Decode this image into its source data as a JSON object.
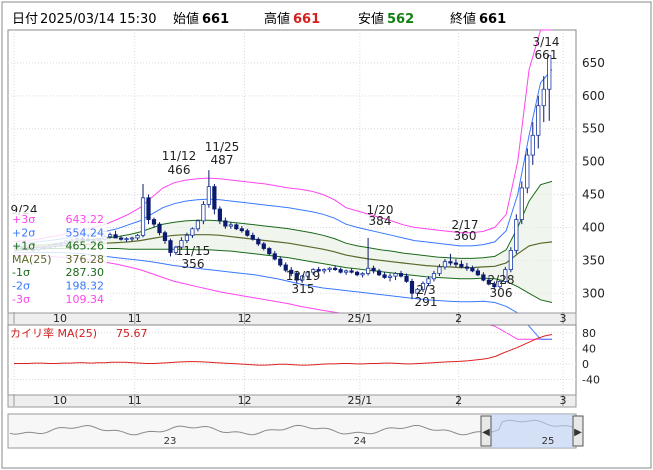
{
  "header": {
    "date_label": "日付",
    "date_value": "2025/03/14 15:30",
    "open_label": "始値",
    "open_value": "661",
    "high_label": "高値",
    "high_value": "661",
    "low_label": "安値",
    "low_value": "562",
    "close_label": "終値",
    "close_value": "661"
  },
  "colors": {
    "up": "#1a3aa8",
    "down": "#0a1a6e",
    "band3": "#ff44ee",
    "band2": "#3a78ff",
    "band1": "#1a6a1a",
    "ma": "#5a6a2a",
    "high": "#d22020",
    "low": "#128012",
    "sub_line": "#dd2222"
  },
  "legend": [
    {
      "label": "+3σ",
      "value": "643.22",
      "color": "#ff44ee"
    },
    {
      "label": "+2σ",
      "value": "554.24",
      "color": "#3a78ff"
    },
    {
      "label": "+1σ",
      "value": "465.26",
      "color": "#1a6a1a"
    },
    {
      "label": "MA(25)",
      "value": "376.28",
      "color": "#5a6a2a"
    },
    {
      "label": "-1σ",
      "value": "287.30",
      "color": "#1a6a1a"
    },
    {
      "label": "-2σ",
      "value": "198.32",
      "color": "#3a78ff"
    },
    {
      "label": "-3σ",
      "value": "109.34",
      "color": "#ff44ee"
    }
  ],
  "month_labels": [
    "10",
    "11",
    "12",
    "25/1",
    "2",
    "3"
  ],
  "annotations": [
    {
      "date": "9/24",
      "value": ""
    },
    {
      "date": "11/12",
      "value": "466"
    },
    {
      "date": "11/25",
      "value": "487"
    },
    {
      "date": "1/20",
      "value": "384"
    },
    {
      "date": "2/17",
      "value": "360"
    },
    {
      "date": "3/14",
      "value": "661"
    },
    {
      "date": "11/15",
      "value": "356"
    },
    {
      "date": "12/19",
      "value": "315"
    },
    {
      "date": "2/3",
      "value": "291"
    },
    {
      "date": "2/28",
      "value": "306"
    }
  ],
  "sub_panel": {
    "label": "カイリ率 MA(25)",
    "value": "75.67",
    "y_ticks": [
      "80",
      "40",
      "0",
      "-40"
    ]
  },
  "navigator": {
    "labels": [
      "23",
      "24",
      "25"
    ],
    "left_button": "◀",
    "right_button": "▶"
  },
  "chart_data": {
    "type": "candlestick",
    "ylim": [
      270,
      700
    ],
    "y_ticks": [
      300,
      350,
      400,
      450,
      500,
      550,
      600,
      650
    ],
    "x_months": [
      {
        "label": "10",
        "index": 0
      },
      {
        "label": "11",
        "index": 22
      },
      {
        "label": "12",
        "index": 42
      },
      {
        "label": "25/1",
        "index": 63
      },
      {
        "label": "2",
        "index": 81
      },
      {
        "label": "3",
        "index": 100
      }
    ],
    "candles": [
      [
        370,
        372,
        366,
        369
      ],
      [
        369,
        371,
        365,
        368
      ],
      [
        368,
        370,
        364,
        367
      ],
      [
        367,
        369,
        363,
        366
      ],
      [
        366,
        370,
        364,
        369
      ],
      [
        369,
        372,
        366,
        370
      ],
      [
        370,
        374,
        368,
        372
      ],
      [
        372,
        376,
        369,
        374
      ],
      [
        374,
        378,
        371,
        376
      ],
      [
        376,
        381,
        373,
        379
      ],
      [
        379,
        383,
        376,
        381
      ],
      [
        381,
        385,
        378,
        383
      ],
      [
        383,
        386,
        379,
        382
      ],
      [
        382,
        384,
        378,
        380
      ],
      [
        380,
        383,
        377,
        381
      ],
      [
        381,
        384,
        378,
        382
      ],
      [
        382,
        388,
        380,
        386
      ],
      [
        386,
        392,
        383,
        389
      ],
      [
        389,
        395,
        384,
        384
      ],
      [
        384,
        387,
        380,
        382
      ],
      [
        382,
        385,
        378,
        383
      ],
      [
        383,
        386,
        379,
        384
      ],
      [
        384,
        390,
        381,
        388
      ],
      [
        388,
        466,
        385,
        445
      ],
      [
        445,
        450,
        405,
        412
      ],
      [
        412,
        415,
        400,
        405
      ],
      [
        405,
        408,
        388,
        392
      ],
      [
        392,
        395,
        375,
        380
      ],
      [
        380,
        383,
        356,
        362
      ],
      [
        362,
        372,
        358,
        370
      ],
      [
        370,
        385,
        366,
        380
      ],
      [
        380,
        392,
        376,
        388
      ],
      [
        388,
        400,
        384,
        398
      ],
      [
        398,
        412,
        394,
        410
      ],
      [
        410,
        440,
        405,
        435
      ],
      [
        435,
        487,
        430,
        462
      ],
      [
        462,
        466,
        420,
        428
      ],
      [
        428,
        432,
        405,
        410
      ],
      [
        410,
        415,
        398,
        402
      ],
      [
        402,
        408,
        398,
        404
      ],
      [
        404,
        406,
        396,
        398
      ],
      [
        398,
        402,
        392,
        395
      ],
      [
        395,
        398,
        386,
        388
      ],
      [
        388,
        392,
        380,
        382
      ],
      [
        382,
        385,
        372,
        375
      ],
      [
        375,
        378,
        365,
        368
      ],
      [
        368,
        370,
        358,
        360
      ],
      [
        360,
        364,
        350,
        352
      ],
      [
        352,
        356,
        340,
        343
      ],
      [
        343,
        347,
        332,
        335
      ],
      [
        335,
        340,
        326,
        330
      ],
      [
        330,
        334,
        315,
        320
      ],
      [
        320,
        328,
        316,
        326
      ],
      [
        326,
        334,
        322,
        332
      ],
      [
        332,
        338,
        328,
        336
      ],
      [
        336,
        340,
        332,
        334
      ],
      [
        334,
        338,
        330,
        336
      ],
      [
        336,
        340,
        332,
        338
      ],
      [
        338,
        342,
        334,
        336
      ],
      [
        336,
        339,
        330,
        332
      ],
      [
        332,
        336,
        328,
        334
      ],
      [
        334,
        338,
        330,
        332
      ],
      [
        332,
        334,
        326,
        328
      ],
      [
        328,
        332,
        324,
        330
      ],
      [
        330,
        384,
        327,
        338
      ],
      [
        338,
        342,
        330,
        334
      ],
      [
        334,
        337,
        326,
        328
      ],
      [
        328,
        332,
        322,
        324
      ],
      [
        324,
        330,
        318,
        326
      ],
      [
        326,
        332,
        320,
        330
      ],
      [
        330,
        334,
        324,
        326
      ],
      [
        326,
        330,
        316,
        318
      ],
      [
        318,
        322,
        291,
        300
      ],
      [
        300,
        308,
        295,
        306
      ],
      [
        306,
        318,
        302,
        315
      ],
      [
        315,
        326,
        311,
        322
      ],
      [
        322,
        334,
        318,
        330
      ],
      [
        330,
        344,
        326,
        340
      ],
      [
        340,
        352,
        336,
        348
      ],
      [
        348,
        360,
        342,
        346
      ],
      [
        346,
        352,
        340,
        344
      ],
      [
        344,
        350,
        338,
        340
      ],
      [
        340,
        346,
        334,
        338
      ],
      [
        338,
        342,
        332,
        334
      ],
      [
        334,
        338,
        326,
        328
      ],
      [
        328,
        332,
        318,
        320
      ],
      [
        320,
        324,
        312,
        314
      ],
      [
        314,
        318,
        306,
        310
      ],
      [
        310,
        320,
        308,
        318
      ],
      [
        318,
        340,
        314,
        336
      ],
      [
        336,
        370,
        332,
        365
      ],
      [
        365,
        420,
        360,
        412
      ],
      [
        412,
        470,
        405,
        460
      ],
      [
        460,
        520,
        452,
        510
      ],
      [
        510,
        560,
        495,
        540
      ],
      [
        540,
        600,
        520,
        585
      ],
      [
        585,
        630,
        560,
        610
      ],
      [
        610,
        661,
        562,
        661
      ]
    ],
    "bands": {
      "plus3": [
        378,
        380,
        382,
        385,
        388,
        392,
        396,
        400,
        405,
        412,
        420,
        430,
        445,
        460,
        468,
        472,
        474,
        475,
        474,
        472,
        470,
        468,
        466,
        463,
        460,
        458,
        455,
        450,
        442,
        430,
        425,
        420,
        415,
        410,
        404,
        400,
        398,
        396,
        394,
        392,
        392,
        394,
        400,
        420,
        500,
        640,
        700,
        700
      ],
      "plus2": [
        374,
        376,
        378,
        380,
        382,
        385,
        388,
        391,
        394,
        398,
        404,
        410,
        420,
        430,
        436,
        440,
        442,
        443,
        442,
        440,
        438,
        436,
        434,
        432,
        430,
        427,
        424,
        420,
        414,
        405,
        400,
        396,
        392,
        388,
        384,
        380,
        378,
        376,
        374,
        372,
        372,
        374,
        378,
        395,
        450,
        540,
        620,
        640
      ],
      "plus1": [
        371,
        372,
        373,
        374,
        376,
        378,
        380,
        382,
        384,
        386,
        389,
        393,
        399,
        405,
        408,
        410,
        411,
        411,
        410,
        408,
        406,
        404,
        402,
        400,
        398,
        395,
        392,
        388,
        383,
        376,
        372,
        369,
        366,
        364,
        361,
        359,
        357,
        355,
        354,
        353,
        353,
        354,
        356,
        366,
        400,
        440,
        465,
        470
      ],
      "ma": [
        368,
        369,
        370,
        371,
        372,
        373,
        374,
        375,
        376,
        377,
        378,
        380,
        383,
        386,
        388,
        389,
        389,
        389,
        388,
        386,
        384,
        382,
        380,
        378,
        376,
        373,
        370,
        367,
        363,
        358,
        355,
        352,
        350,
        348,
        346,
        344,
        342,
        341,
        340,
        339,
        339,
        340,
        341,
        346,
        360,
        372,
        376,
        378
      ],
      "minus1": [
        365,
        366,
        367,
        368,
        368,
        368,
        368,
        368,
        368,
        368,
        367,
        367,
        367,
        367,
        367,
        367,
        366,
        366,
        365,
        364,
        362,
        360,
        358,
        356,
        354,
        351,
        348,
        345,
        342,
        339,
        337,
        335,
        333,
        331,
        329,
        327,
        325,
        324,
        323,
        322,
        322,
        323,
        322,
        318,
        310,
        300,
        290,
        286
      ],
      "minus2": [
        362,
        362,
        362,
        362,
        362,
        361,
        360,
        358,
        356,
        354,
        352,
        350,
        348,
        345,
        342,
        340,
        338,
        336,
        334,
        332,
        330,
        328,
        325,
        322,
        318,
        314,
        311,
        308,
        306,
        304,
        302,
        300,
        298,
        296,
        294,
        292,
        290,
        289,
        288,
        287,
        287,
        288,
        286,
        280,
        270,
        250,
        220,
        200
      ],
      "minus3": [
        358,
        358,
        357,
        356,
        355,
        354,
        352,
        350,
        347,
        344,
        340,
        336,
        330,
        324,
        318,
        314,
        310,
        306,
        302,
        299,
        296,
        293,
        290,
        287,
        284,
        280,
        277,
        274,
        271,
        269,
        268,
        266,
        264,
        262,
        260,
        258,
        256,
        255,
        254,
        253,
        253,
        254,
        250,
        240,
        220,
        200,
        170,
        140
      ]
    },
    "subchart": {
      "ylim": [
        -80,
        100
      ],
      "values": [
        1,
        1,
        1,
        2,
        2,
        1,
        1,
        2,
        2,
        3,
        3,
        2,
        3,
        3,
        4,
        4,
        4,
        3,
        2,
        1,
        1,
        2,
        3,
        4,
        5,
        6,
        6,
        5,
        4,
        3,
        2,
        1,
        0,
        -1,
        -2,
        -3,
        -3,
        -2,
        -1,
        -1,
        -2,
        -3,
        -3,
        -2,
        -1,
        0,
        0,
        1,
        1,
        0,
        0,
        1,
        1,
        2,
        2,
        1,
        0,
        0,
        1,
        2,
        3,
        4,
        5,
        6,
        7,
        8,
        10,
        12,
        15,
        20,
        28,
        35,
        42,
        50,
        58,
        66,
        72,
        75.67
      ]
    }
  }
}
